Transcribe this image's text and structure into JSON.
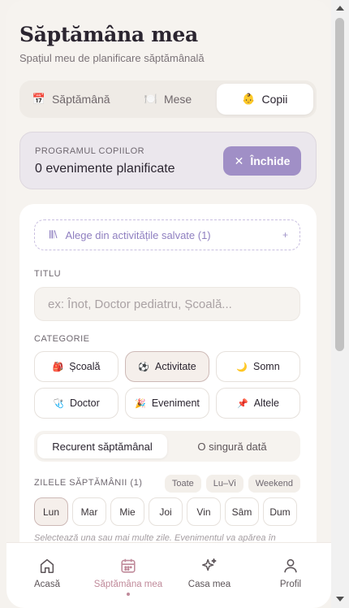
{
  "header": {
    "title": "Săptămâna mea",
    "subtitle": "Spațiul meu de planificare săptămânală"
  },
  "tabs": [
    {
      "label": "Săptămână",
      "icon": "calendar-icon",
      "active": false
    },
    {
      "label": "Mese",
      "icon": "plate-icon",
      "active": false
    },
    {
      "label": "Copii",
      "icon": "baby-face-icon",
      "active": true
    }
  ],
  "status": {
    "label": "PROGRAMUL COPIILOR",
    "value": "0 evenimente planificate",
    "close_label": "Închide"
  },
  "form": {
    "saved_activities_label": "Alege din activitățile salvate (1)",
    "title_label": "TITLU",
    "title_placeholder": "ex: Înot, Doctor pediatru, Școală...",
    "category_label": "CATEGORIE",
    "categories": [
      {
        "label": "Școală",
        "icon": "backpack-icon",
        "active": false
      },
      {
        "label": "Activitate",
        "icon": "ball-icon",
        "active": true
      },
      {
        "label": "Somn",
        "icon": "moon-icon",
        "active": false
      },
      {
        "label": "Doctor",
        "icon": "stethoscope-icon",
        "active": false
      },
      {
        "label": "Eveniment",
        "icon": "party-icon",
        "active": false
      },
      {
        "label": "Altele",
        "icon": "pin-icon",
        "active": false
      }
    ],
    "recurrence": {
      "options": [
        "Recurent săptămânal",
        "O singură dată"
      ],
      "selected": "Recurent săptămânal"
    },
    "days_label": "ZILELE SĂPTĂMÂNII (1)",
    "quick_select": [
      "Toate",
      "Lu–Vi",
      "Weekend"
    ],
    "days": [
      {
        "label": "Lun",
        "active": true
      },
      {
        "label": "Mar",
        "active": false
      },
      {
        "label": "Mie",
        "active": false
      },
      {
        "label": "Joi",
        "active": false
      },
      {
        "label": "Vin",
        "active": false
      },
      {
        "label": "Sâm",
        "active": false
      },
      {
        "label": "Dum",
        "active": false
      }
    ],
    "hint": "Selectează una sau mai multe zile. Evenimentul va apărea în"
  },
  "nav": [
    {
      "label": "Acasă",
      "icon": "home-icon",
      "active": false
    },
    {
      "label": "Săptămâna mea",
      "icon": "calendar-icon",
      "active": true
    },
    {
      "label": "Casa mea",
      "icon": "sparkles-icon",
      "active": false
    },
    {
      "label": "Profil",
      "icon": "user-icon",
      "active": false
    }
  ],
  "colors": {
    "accent": "#a08fc6",
    "nav_active": "#c08a9a",
    "background": "#f6f3ef"
  }
}
